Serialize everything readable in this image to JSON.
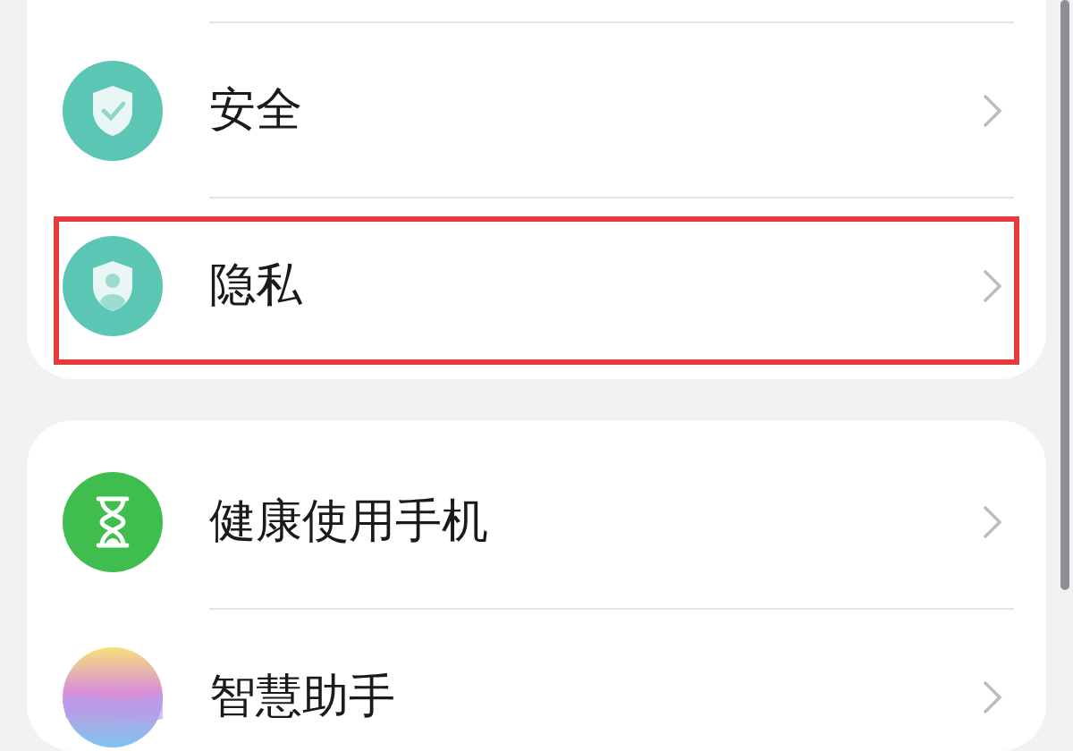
{
  "groups": [
    {
      "cut_above": true,
      "items": [
        {
          "label": "安全",
          "kind": "shield-check",
          "highlighted": false
        },
        {
          "label": "隐私",
          "kind": "shield-person",
          "highlighted": true
        }
      ]
    },
    {
      "cut_above": false,
      "items": [
        {
          "label": "健康使用手机",
          "kind": "hourglass",
          "highlighted": false
        },
        {
          "label": "智慧助手",
          "kind": "assistant",
          "highlighted": false
        }
      ]
    }
  ]
}
